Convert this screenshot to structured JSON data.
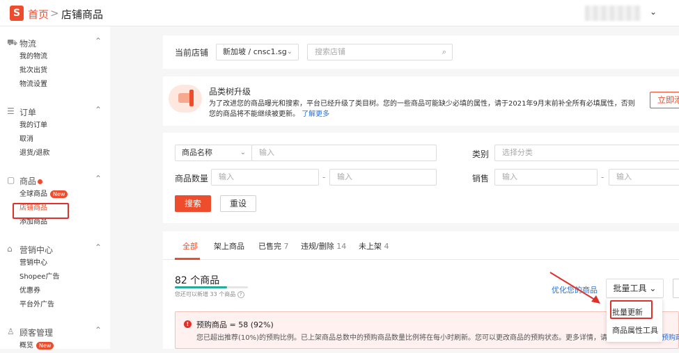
{
  "breadcrumb": {
    "logo": "S",
    "home": "首页",
    "sep": ">",
    "current": "店铺商品"
  },
  "account": {
    "caret": "⌄"
  },
  "sidebar": {
    "groups": [
      {
        "icon": "truck-icon",
        "glyph": "⛟",
        "title": "物流",
        "chev": "⌃",
        "items": [
          "我的物流",
          "批次出货",
          "物流设置"
        ]
      },
      {
        "icon": "list-icon",
        "glyph": "☰",
        "title": "订单",
        "chev": "⌃",
        "items": [
          "我的订单",
          "取消",
          "退货/退款"
        ]
      },
      {
        "icon": "box-icon",
        "glyph": "▢",
        "title": "商品",
        "chev": "⌃",
        "items": [
          "全球商品",
          "店铺商品",
          "添加商品"
        ],
        "new_label": "New"
      },
      {
        "icon": "tag-icon",
        "glyph": "⌂",
        "title": "营销中心",
        "chev": "⌃",
        "items": [
          "营销中心",
          "Shopee广告",
          "优惠券",
          "平台外广告"
        ]
      },
      {
        "icon": "customer-icon",
        "glyph": "♙",
        "title": "顾客管理",
        "chev": "⌃",
        "items": [
          "概览"
        ],
        "new_label": "New"
      }
    ]
  },
  "store": {
    "label": "当前店铺",
    "selected": "新加坡 / cnsc1.sg",
    "search_placeholder": "搜索店铺"
  },
  "notice": {
    "title": "品类树升级",
    "line1": "为了改进您的商品曝光和搜索，平台已经升级了类目树。您的一些商品可能缺少必填的属性，请于2021年9月末前补全所有必填属性，否则",
    "line2": "您的商品将不能继续被更新。",
    "link": "了解更多",
    "button": "立即添"
  },
  "filters": {
    "name_select": "商品名称",
    "name_placeholder": "输入",
    "category_label": "类别",
    "category_placeholder": "选择分类",
    "qty_label": "商品数量",
    "qty_min": "输入",
    "qty_max": "输入",
    "dash": "-",
    "sales_label": "销售",
    "sales_min": "输入",
    "sales_max": "输入",
    "search_btn": "搜索",
    "reset_btn": "重设"
  },
  "tabs": [
    {
      "label": "全部",
      "count": ""
    },
    {
      "label": "架上商品",
      "count": ""
    },
    {
      "label": "已售完",
      "count": "7"
    },
    {
      "label": "违规/删除",
      "count": "14"
    },
    {
      "label": "未上架",
      "count": "4"
    }
  ],
  "summary": {
    "count_text": "82 个商品",
    "sub_text": "您还可以新增 33 个商品",
    "optimize_link": "优化您的商品",
    "bulk_btn": "批量工具",
    "progress": 0.71
  },
  "dropdown": {
    "items": [
      "批量更新",
      "商品属性工具"
    ]
  },
  "alert": {
    "title": "预购商品 = 58 (92%)",
    "body": "您已超出推荐(10%)的预购比例。已上架商品总数中的预购商品数量比例将在每小时刷新。您可以更改商品的预购状态。更多详情，请",
    "tail": "预购政"
  },
  "colors": {
    "brand": "#ee4d2d",
    "link": "#2673dd",
    "annotation": "#e0302a"
  }
}
